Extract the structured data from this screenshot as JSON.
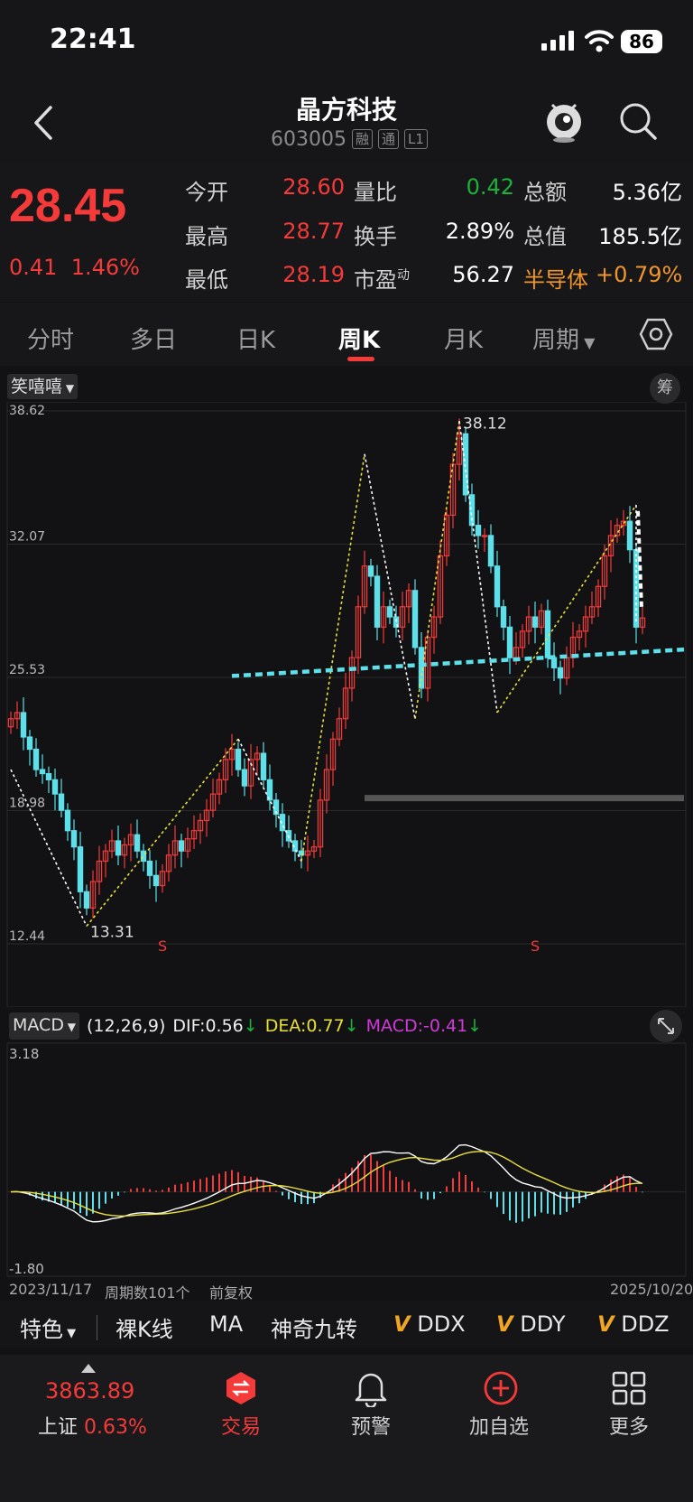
{
  "status": {
    "time": "22:41",
    "battery": "86"
  },
  "header": {
    "title": "晶方科技",
    "code": "603005",
    "tags": [
      "融",
      "通",
      "L1"
    ]
  },
  "quote": {
    "price": "28.45",
    "change": "0.41",
    "change_pct": "1.46%",
    "rows": [
      [
        {
          "label": "今开",
          "value": "28.60"
        },
        {
          "label": "量比",
          "value": "0.42"
        },
        {
          "label": "总额",
          "value": "5.36亿"
        }
      ],
      [
        {
          "label": "最高",
          "value": "28.77"
        },
        {
          "label": "换手",
          "value": "2.89%"
        },
        {
          "label": "总值",
          "value": "185.5亿"
        }
      ],
      [
        {
          "label": "最低",
          "value": "28.19"
        },
        {
          "label": "市盈",
          "sup": "动",
          "value": "56.27"
        },
        {
          "label": "半导体",
          "value": "+0.79%"
        }
      ]
    ],
    "colors": {
      "up": "#f53a3a",
      "down": "#19b33a"
    }
  },
  "tabs": [
    "分时",
    "多日",
    "日K",
    "周K",
    "月K",
    "周期"
  ],
  "active_tab": "周K",
  "chart": {
    "indicator": "笑嘻嘻",
    "chips_label": "筹",
    "y_labels": [
      "38.62",
      "32.07",
      "25.53",
      "18.98",
      "12.44"
    ],
    "high_label": "38.12",
    "low_label": "13.31",
    "signal_label": "S",
    "start_date": "2023/11/17",
    "end_date": "2025/10/20",
    "period_count": "周期数101个",
    "adjust": "前复权"
  },
  "chart_data": {
    "type": "candlestick",
    "ylim": [
      12.44,
      38.62
    ],
    "period_count": 101,
    "start_date": "2023/11/17",
    "end_date": "2025/10/20",
    "high": 38.12,
    "low": 13.31,
    "close_series": [
      23.5,
      23.8,
      22.6,
      22.0,
      21.0,
      20.8,
      20.5,
      19.8,
      19.0,
      18.0,
      17.2,
      15.0,
      14.2,
      15.5,
      16.5,
      17.0,
      17.5,
      16.8,
      17.3,
      17.8,
      17.0,
      16.5,
      15.8,
      15.3,
      16.0,
      16.8,
      17.5,
      17.0,
      17.6,
      18.0,
      18.5,
      19.0,
      19.8,
      20.5,
      21.5,
      22.0,
      21.0,
      20.2,
      21.5,
      21.8,
      20.5,
      19.5,
      18.8,
      18.0,
      17.5,
      17.0,
      16.8,
      17.0,
      17.2,
      19.5,
      21.0,
      22.5,
      23.5,
      25.0,
      26.5,
      29.0,
      31.0,
      30.5,
      28.0,
      29.0,
      28.5,
      28.0,
      29.0,
      29.8,
      27.0,
      25.0,
      27.5,
      28.5,
      31.5,
      33.5,
      36.0,
      37.5,
      34.5,
      33.0,
      32.5,
      32.5,
      31.0,
      29.0,
      28.0,
      26.5,
      27.0,
      27.8,
      28.5,
      28.0,
      28.8,
      26.5,
      26.0,
      25.5,
      26.5,
      27.5,
      27.8,
      28.5,
      29.0,
      30.0,
      31.5,
      32.5,
      33.0,
      33.2,
      31.8,
      28.0,
      28.45
    ],
    "macd": {
      "params": "(12,26,9)",
      "dif": "0.56",
      "dea": "0.77",
      "macd": "-0.41",
      "ylim": [
        -1.8,
        3.18
      ]
    }
  },
  "macd_header": {
    "name": "MACD",
    "params": "(12,26,9)",
    "dif_label": "DIF:",
    "dif": "0.56",
    "dea_label": "DEA:",
    "dea": "0.77",
    "macd_label": "MACD:",
    "macd": "-0.41",
    "ymax": "3.18",
    "ymin": "-1.80"
  },
  "indicator_row": {
    "special": "特色",
    "items": [
      "裸K线",
      "MA",
      "神奇九转"
    ],
    "v_items": [
      "DDX",
      "DDY",
      "DDZ"
    ]
  },
  "bottom": {
    "index_value": "3863.89",
    "index_name": "上证",
    "index_change": "0.63%",
    "items": [
      "交易",
      "预警",
      "加自选",
      "更多"
    ]
  }
}
